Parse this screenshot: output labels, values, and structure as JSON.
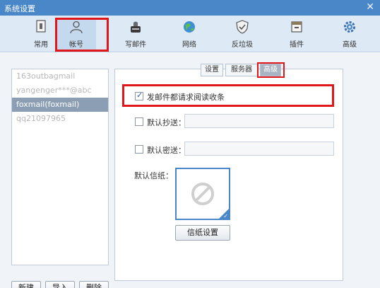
{
  "window": {
    "title": "系统设置",
    "close_glyph": "✕"
  },
  "toolbar": {
    "items": [
      {
        "label": "常用",
        "icon": "settings-panel-icon"
      },
      {
        "label": "帐号",
        "icon": "user-icon"
      },
      {
        "label": "写邮件",
        "icon": "compose-icon"
      },
      {
        "label": "网络",
        "icon": "globe-icon"
      },
      {
        "label": "反垃圾",
        "icon": "shield-icon"
      },
      {
        "label": "插件",
        "icon": "plugin-icon"
      },
      {
        "label": "高级",
        "icon": "gear-icon"
      }
    ],
    "active_label": "帐号"
  },
  "accounts": {
    "items": [
      "163outbagmail",
      "yangenger***@abc",
      "foxmail(foxmail)",
      "qq21097965"
    ],
    "selected": "foxmail(foxmail)"
  },
  "account_buttons": {
    "new": "新建",
    "import": "导入",
    "delete": "删除"
  },
  "tabs": {
    "settings": "设置",
    "server": "服务器",
    "advanced": "高级"
  },
  "advanced": {
    "read_receipt": {
      "label": "发邮件都请求阅读收条",
      "checked": true
    },
    "default_cc": {
      "label": "默认抄送：",
      "checked": false,
      "value": ""
    },
    "default_bcc": {
      "label": "默认密送：",
      "checked": false,
      "value": ""
    },
    "stationery": {
      "label": "默认信纸：",
      "button": "信纸设置"
    }
  },
  "colors": {
    "highlight": "#e0161b",
    "accent": "#4a87c8"
  }
}
